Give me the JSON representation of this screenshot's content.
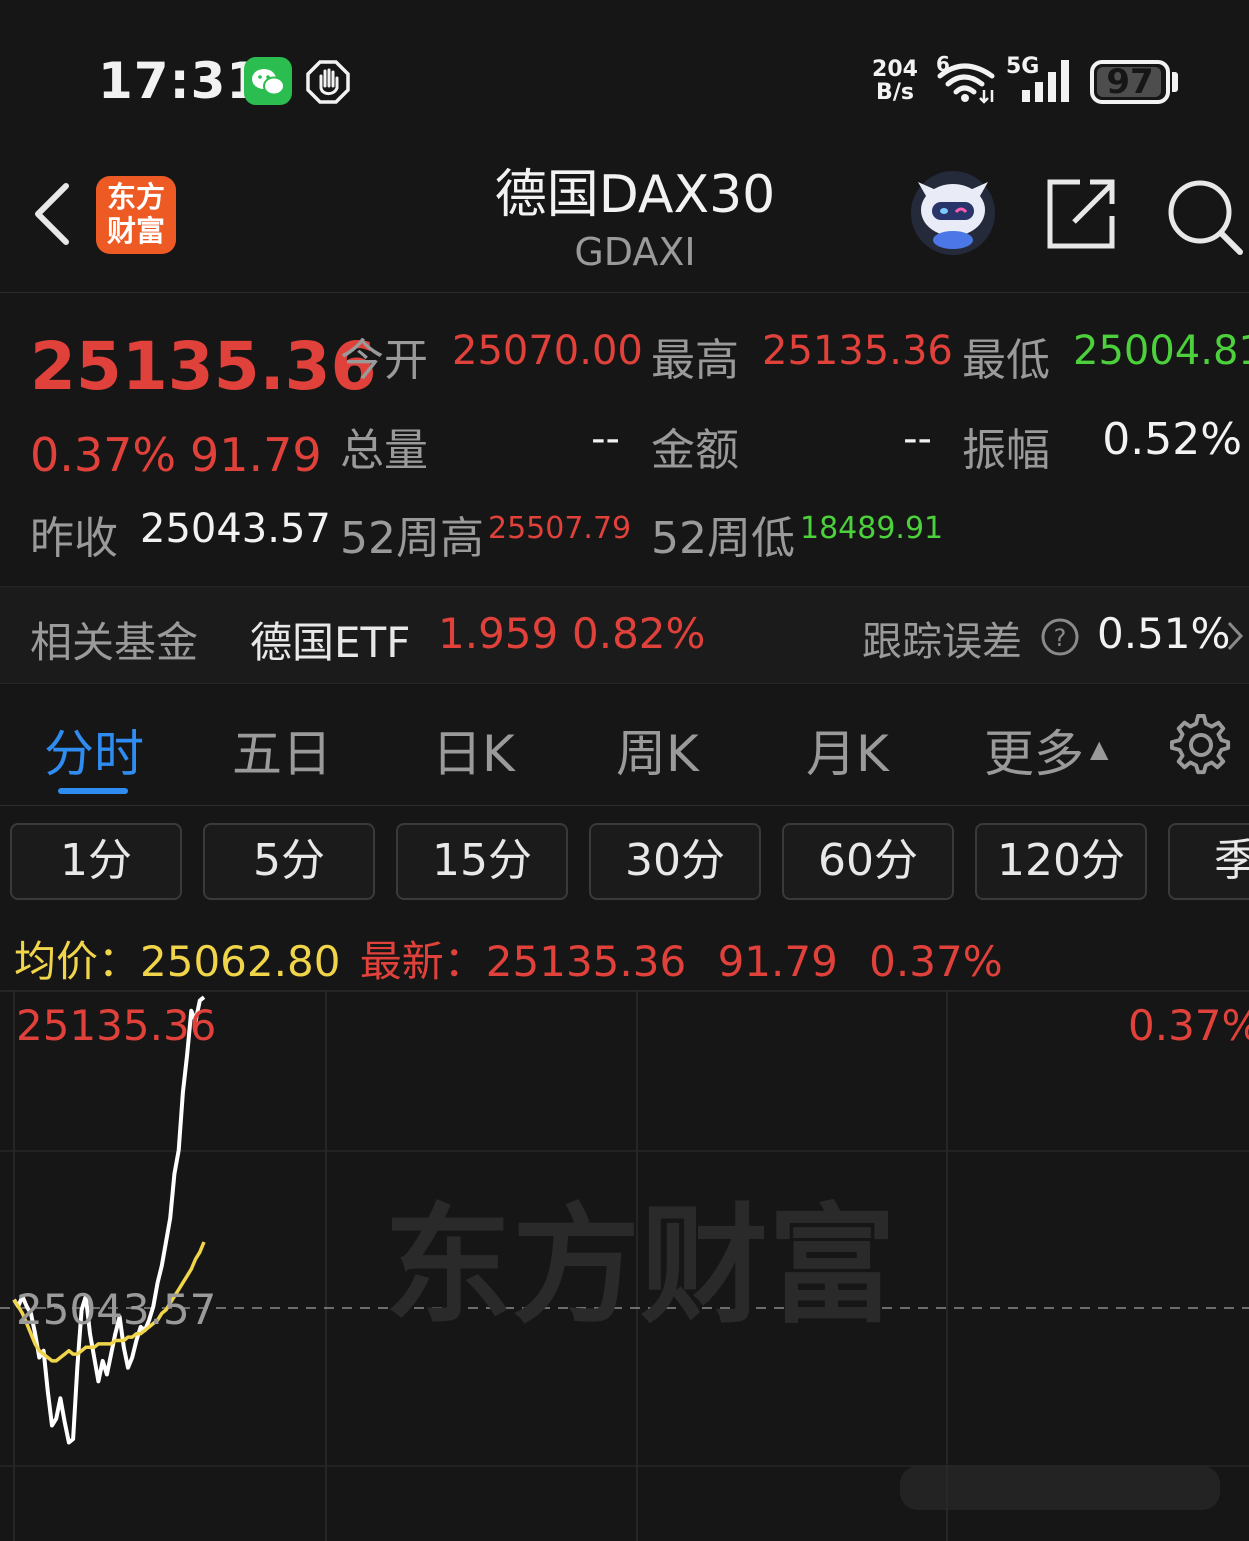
{
  "status_bar": {
    "time": "17:31",
    "net_speed_value": "204",
    "net_speed_unit": "B/s",
    "wifi_badge": "6",
    "cell_badge": "5G",
    "battery": "97",
    "battery_level": 0.97,
    "icons": [
      "wechat-icon",
      "hand-icon",
      "wifi-icon",
      "signal-icon",
      "battery-icon"
    ]
  },
  "header": {
    "logo_line1": "东方",
    "logo_line2": "财富",
    "title": "德国DAX30",
    "subtitle": "GDAXI",
    "icons": [
      "back-icon",
      "robot-avatar",
      "share-icon",
      "search-icon"
    ]
  },
  "quote": {
    "last_price": "25135.36",
    "change_pct": "0.37%",
    "change_val": "91.79",
    "prev_close_label": "昨收",
    "prev_close": "25043.57",
    "open_label": "今开",
    "open": "25070.00",
    "high_label": "最高",
    "high": "25135.36",
    "low_label": "最低",
    "low": "25004.81",
    "volume_label": "总量",
    "volume": "--",
    "amount_label": "金额",
    "amount": "--",
    "amplitude_label": "振幅",
    "amplitude": "0.52%",
    "w52_high_label": "52周高",
    "w52_high": "25507.79",
    "w52_low_label": "52周低",
    "w52_low": "18489.91"
  },
  "related_fund": {
    "label": "相关基金",
    "name": "德国ETF",
    "price": "1.959",
    "change": "0.82%",
    "tracking_label": "跟踪误差",
    "tracking_value": "0.51%"
  },
  "period_tabs": {
    "items": [
      "分时",
      "五日",
      "日K",
      "周K",
      "月K",
      "更多"
    ],
    "active": "分时"
  },
  "minute_chips": [
    "1分",
    "5分",
    "15分",
    "30分",
    "60分",
    "120分",
    "季"
  ],
  "legend": {
    "avg_label": "均价：",
    "avg_value": "25062.80",
    "latest_label": "最新：",
    "latest_value": "25135.36",
    "latest_change": "91.79",
    "latest_pct": "0.37%"
  },
  "chart_data": {
    "type": "line",
    "top_label": "25135.36",
    "top_pct": "0.37%",
    "baseline_label": "25043.57",
    "watermark": "东方财富",
    "y_range": [
      24951.78,
      25135.36
    ],
    "baseline": 25043.57,
    "series": [
      {
        "color": "#ffffff",
        "values": [
          25046,
          25044,
          25047,
          25044,
          25042,
          25036,
          25029,
          25031,
          25019,
          25009,
          25011,
          25017,
          25010,
          25004,
          25005,
          25026,
          25043,
          25047,
          25036,
          25029,
          25022,
          25028,
          25024,
          25030,
          25036,
          25041,
          25032,
          25026,
          25029,
          25034,
          25038,
          25037,
          25040,
          25044,
          25051,
          25056,
          25063,
          25070,
          25083,
          25090,
          25107,
          25118,
          25131,
          25128,
          25134,
          25135
        ]
      },
      {
        "color": "#f0d44a",
        "values": [
          25046,
          25044,
          25042,
          25039,
          25036,
          25033,
          25031,
          25030,
          25029,
          25028,
          25028,
          25029,
          25030,
          25031,
          25030,
          25030,
          25031,
          25032,
          25032,
          25032,
          25033,
          25033,
          25033,
          25033,
          25034,
          25034,
          25034,
          25035,
          25035,
          25036,
          25036,
          25037,
          25038,
          25039,
          25040,
          25042,
          25043,
          25045,
          25047,
          25049,
          25051,
          25053,
          25055,
          25058,
          25060,
          25063
        ]
      }
    ]
  }
}
